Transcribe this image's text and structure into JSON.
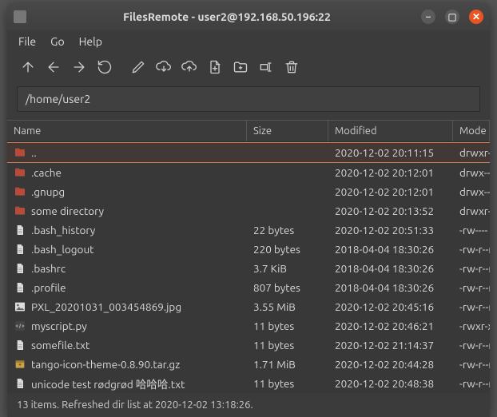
{
  "window": {
    "title": "FilesRemote - user2@192.168.50.196:22"
  },
  "menu": {
    "file": "File",
    "go": "Go",
    "help": "Help"
  },
  "path": "/home/user2",
  "columns": {
    "name": "Name",
    "size": "Size",
    "modified": "Modified",
    "mode": "Mode"
  },
  "rows": [
    {
      "icon": "folder",
      "name": "..",
      "size": "",
      "modified": "2020-12-02 20:11:15",
      "mode": "drwxr-",
      "selected": true
    },
    {
      "icon": "folder",
      "name": ".cache",
      "size": "",
      "modified": "2020-12-02 20:12:01",
      "mode": "drwx--"
    },
    {
      "icon": "folder",
      "name": ".gnupg",
      "size": "",
      "modified": "2020-12-02 20:12:01",
      "mode": "drwx--"
    },
    {
      "icon": "folder",
      "name": "some directory",
      "size": "",
      "modified": "2020-12-02 20:13:52",
      "mode": "drwxr-"
    },
    {
      "icon": "file",
      "name": ".bash_history",
      "size": "22 bytes",
      "modified": "2020-12-02 20:51:33",
      "mode": "-rw----"
    },
    {
      "icon": "file",
      "name": ".bash_logout",
      "size": "220 bytes",
      "modified": "2018-04-04 18:30:26",
      "mode": "-rw-r--r"
    },
    {
      "icon": "file",
      "name": ".bashrc",
      "size": "3.7 KiB",
      "modified": "2018-04-04 18:30:26",
      "mode": "-rw-r--r"
    },
    {
      "icon": "file",
      "name": ".profile",
      "size": "807 bytes",
      "modified": "2018-04-04 18:30:26",
      "mode": "-rw-r--r"
    },
    {
      "icon": "image",
      "name": "PXL_20201031_003454869.jpg",
      "size": "3.55 MiB",
      "modified": "2020-12-02 20:45:16",
      "mode": "-rw-r--r"
    },
    {
      "icon": "python",
      "name": "myscript.py",
      "size": "11 bytes",
      "modified": "2020-12-02 20:46:21",
      "mode": "-rwxr-x"
    },
    {
      "icon": "file",
      "name": "somefile.txt",
      "size": "11 bytes",
      "modified": "2020-12-02 21:14:37",
      "mode": "-rw-r--r"
    },
    {
      "icon": "archive",
      "name": "tango-icon-theme-0.8.90.tar.gz",
      "size": "1.71 MiB",
      "modified": "2020-12-02 20:44:28",
      "mode": "-rw-r--r"
    },
    {
      "icon": "file",
      "name": "unicode test rødgrød 哈哈哈.txt",
      "size": "11 bytes",
      "modified": "2020-12-02 20:48:38",
      "mode": "-rw-r--r"
    }
  ],
  "status": "13 items. Refreshed dir list at 2020-12-02 13:18:26."
}
